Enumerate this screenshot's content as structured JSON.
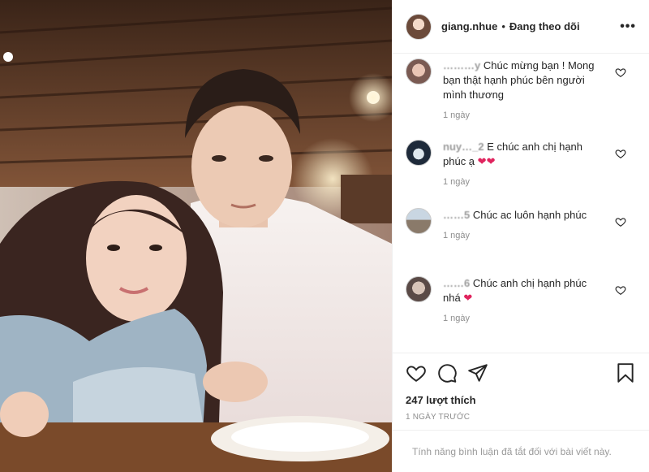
{
  "post": {
    "username": "giang.nhue",
    "separator": "•",
    "follow_status": "Đang theo dõi",
    "more": "•••"
  },
  "comments": [
    {
      "user": "………y",
      "text": "Chúc mừng bạn ! Mong bạn thật hạnh phúc bên người mình thương",
      "hearts": "",
      "time": "1 ngày"
    },
    {
      "user": "nuy…_2",
      "text": "E chúc anh chị hạnh phúc ạ",
      "hearts": "❤❤",
      "time": "1 ngày"
    },
    {
      "user": "……5",
      "text": "Chúc ac luôn hạnh phúc",
      "hearts": "",
      "time": "1 ngày"
    },
    {
      "user": "……6",
      "text": "Chúc anh chị hạnh phúc nhá",
      "hearts": "❤",
      "time": "1 ngày"
    }
  ],
  "actions": {
    "icons": [
      "heart-icon",
      "comment-icon",
      "share-icon",
      "bookmark-icon"
    ],
    "likes": "247 lượt thích",
    "posted": "1 NGÀY TRƯỚC"
  },
  "comment_box": {
    "disabled_text": "Tính năng bình luận đã tắt đối với bài viết này."
  },
  "colors": {
    "heart_red": "#e0245e",
    "text": "#262626",
    "muted": "#8e8e8e"
  }
}
